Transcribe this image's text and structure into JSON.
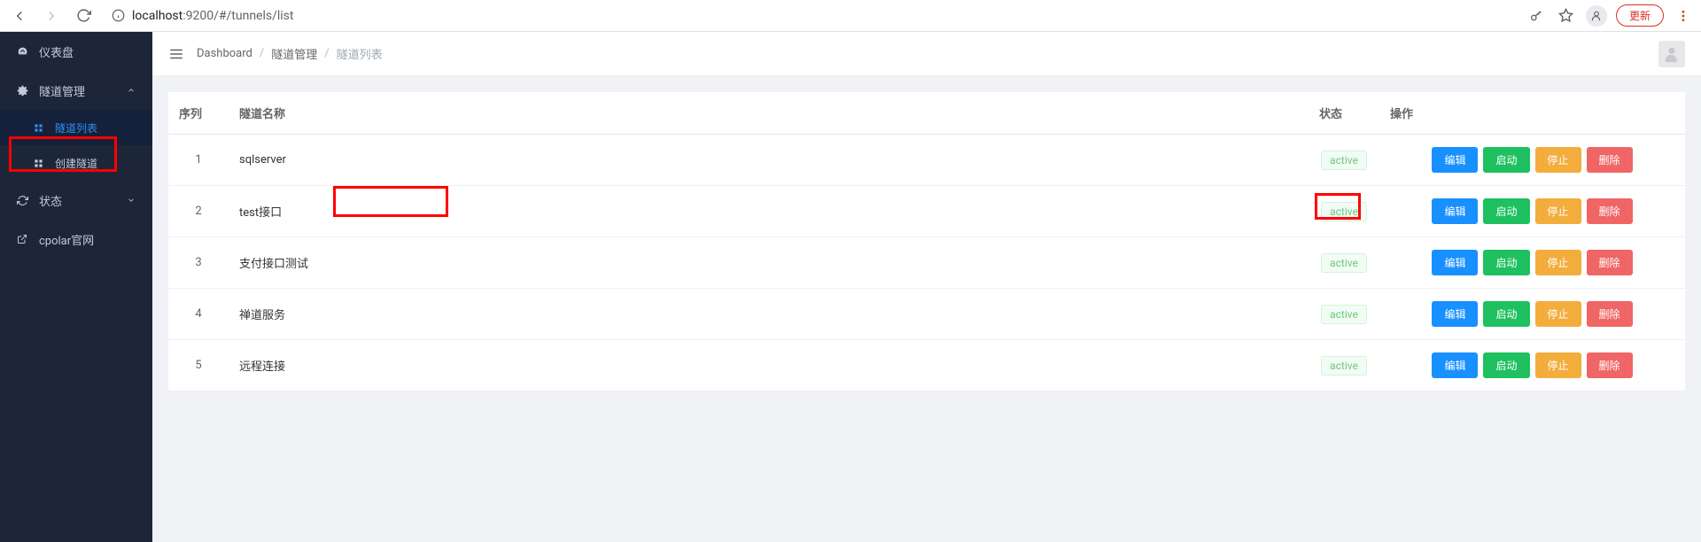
{
  "browser": {
    "url_host": "localhost",
    "url_port_path": ":9200/#/tunnels/list",
    "update_label": "更新"
  },
  "sidebar": {
    "items": [
      {
        "label": "仪表盘",
        "icon": "gauge"
      },
      {
        "label": "隧道管理",
        "icon": "settings",
        "expandable": true
      },
      {
        "label": "隧道列表",
        "icon": "grid",
        "sub": true,
        "active": true
      },
      {
        "label": "创建隧道",
        "icon": "grid",
        "sub": true
      },
      {
        "label": "状态",
        "icon": "refresh",
        "expandable": true
      },
      {
        "label": "cpolar官网",
        "icon": "external"
      }
    ]
  },
  "breadcrumb": {
    "root": "Dashboard",
    "section": "隧道管理",
    "current": "隧道列表"
  },
  "table": {
    "headers": {
      "seq": "序列",
      "name": "隧道名称",
      "status": "状态",
      "actions": "操作"
    },
    "action_labels": {
      "edit": "编辑",
      "start": "启动",
      "stop": "停止",
      "delete": "删除"
    },
    "rows": [
      {
        "seq": "1",
        "name": "sqlserver",
        "status": "active"
      },
      {
        "seq": "2",
        "name": "test接口",
        "status": "active"
      },
      {
        "seq": "3",
        "name": "支付接口测试",
        "status": "active"
      },
      {
        "seq": "4",
        "name": "禅道服务",
        "status": "active"
      },
      {
        "seq": "5",
        "name": "远程连接",
        "status": "active"
      }
    ]
  }
}
